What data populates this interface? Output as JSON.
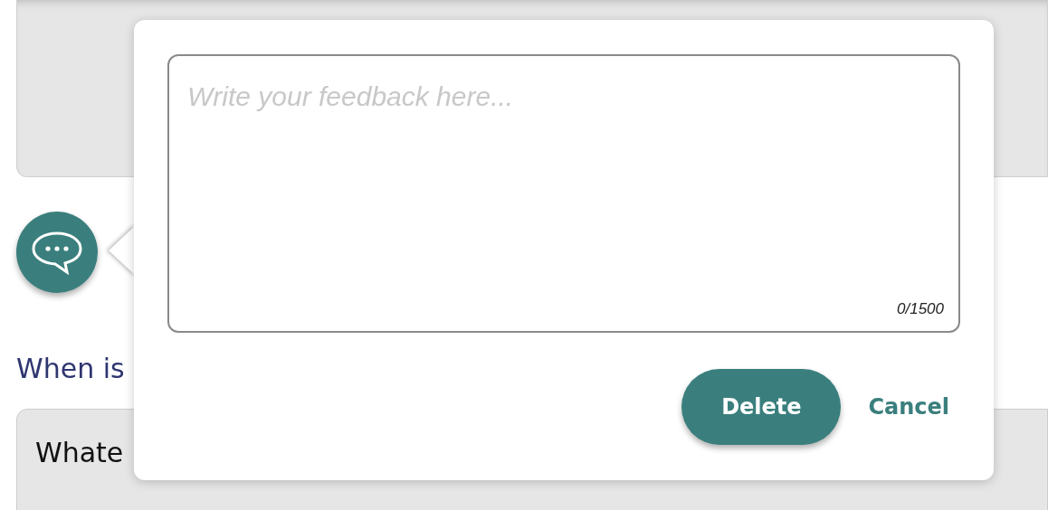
{
  "page": {
    "question": "When is",
    "answer": "Whate"
  },
  "feedback": {
    "placeholder": "Write your feedback here...",
    "counter": "0/1500"
  },
  "buttons": [
    {
      "kind": "primary",
      "label": "Delete"
    },
    {
      "kind": "link",
      "label": "Cancel"
    }
  ]
}
